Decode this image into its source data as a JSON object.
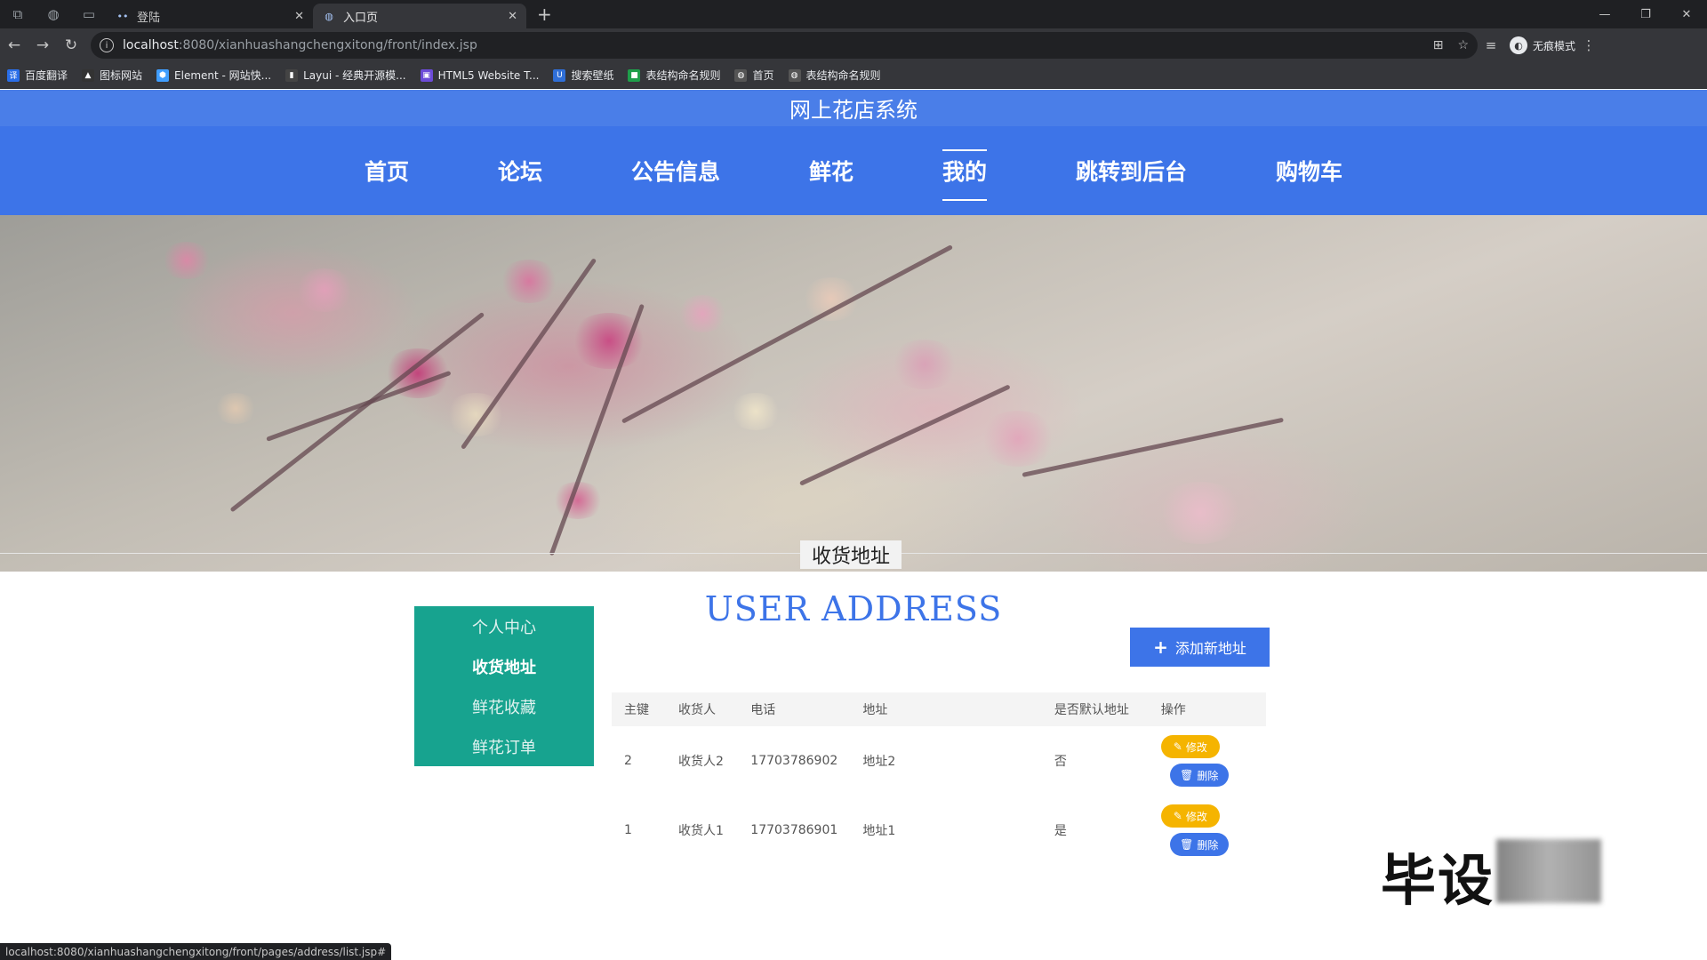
{
  "browser": {
    "tabs": [
      {
        "label": "登陆",
        "active": false
      },
      {
        "label": "入口页",
        "active": true
      }
    ],
    "url_host": "localhost",
    "url_path": ":8080/xianhuashangchengxitong/front/index.jsp",
    "profile_label": "无痕模式",
    "bookmarks": [
      {
        "label": "百度翻译",
        "color": "#2a6ee8"
      },
      {
        "label": "图标网站",
        "color": "#333333"
      },
      {
        "label": "Element - 网站快...",
        "color": "#409eff"
      },
      {
        "label": "Layui - 经典开源模...",
        "color": "#444444"
      },
      {
        "label": "HTML5 Website T...",
        "color": "#6c4bd8"
      },
      {
        "label": "搜索壁纸",
        "color": "#2f6fd8"
      },
      {
        "label": "表结构命名规则",
        "color": "#1e9e4a"
      },
      {
        "label": "首页",
        "color": "#555555"
      },
      {
        "label": "表结构命名规则",
        "color": "#555555"
      }
    ],
    "status_url": "localhost:8080/xianhuashangchengxitong/front/pages/address/list.jsp#"
  },
  "site": {
    "title": "网上花店系统",
    "nav": [
      {
        "label": "首页",
        "active": false
      },
      {
        "label": "论坛",
        "active": false
      },
      {
        "label": "公告信息",
        "active": false
      },
      {
        "label": "鲜花",
        "active": false
      },
      {
        "label": "我的",
        "active": true
      },
      {
        "label": "跳转到后台",
        "active": false
      },
      {
        "label": "购物车",
        "active": false
      }
    ],
    "carousel": {
      "slides": 3,
      "current": 1
    }
  },
  "section": {
    "title_en": "USER ADDRESS",
    "title_cn": "收货地址"
  },
  "sidemenu": [
    {
      "label": "个人中心",
      "active": false
    },
    {
      "label": "收货地址",
      "active": true
    },
    {
      "label": "鲜花收藏",
      "active": false
    },
    {
      "label": "鲜花订单",
      "active": false
    }
  ],
  "panel": {
    "add_button": "添加新地址",
    "columns": [
      "主键",
      "收货人",
      "电话",
      "地址",
      "是否默认地址",
      "操作"
    ],
    "rows": [
      {
        "id": "2",
        "name": "收货人2",
        "phone": "17703786902",
        "address": "地址2",
        "default": "否"
      },
      {
        "id": "1",
        "name": "收货人1",
        "phone": "17703786901",
        "address": "地址1",
        "default": "是"
      }
    ],
    "edit_label": "修改",
    "delete_label": "删除"
  },
  "watermark": "毕设"
}
